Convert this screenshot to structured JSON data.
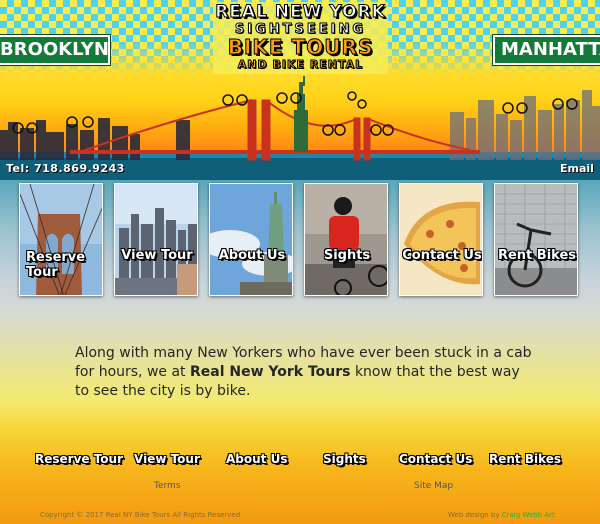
{
  "header": {
    "title_line1": "REAL NEW YORK",
    "title_line2": "SIGHTSEEING",
    "title_line3": "BIKE TOURS",
    "title_line4": "AND BIKE RENTAL",
    "sign_left": "BROOKLYN",
    "sign_right": "MANHATTAN",
    "phone": "Tel:  718.869.9243",
    "email_label": "Email"
  },
  "nav_tiles": [
    {
      "label": "Reserve Tour"
    },
    {
      "label": "View Tour"
    },
    {
      "label": "About Us"
    },
    {
      "label": "Sights"
    },
    {
      "label": "Contact Us"
    },
    {
      "label": "Rent Bikes"
    }
  ],
  "intro": {
    "text_before": "Along with many New Yorkers who have ever been stuck in a cab for hours, we at ",
    "brand": "Real New York Tours",
    "text_after": " know that the best way to see the city is by bike."
  },
  "footer": {
    "links": [
      "Reserve Tour",
      "View Tour",
      "About Us",
      "Sights",
      "Contact Us",
      "Rent Bikes"
    ],
    "terms": "Terms",
    "site_map": "Site Map",
    "copyright": "Copyright © 2017 Real NY Bike Tours All Rights Reserved",
    "credit_prefix": "Web design by ",
    "credit_name": "Craig Webb Art"
  },
  "colors": {
    "sign_green": "#137a3a",
    "checker_blue": "#4fd1f0",
    "checker_yellow": "#f7ec54",
    "bridge_red": "#c8321e",
    "credit_green": "#2fae2f"
  }
}
